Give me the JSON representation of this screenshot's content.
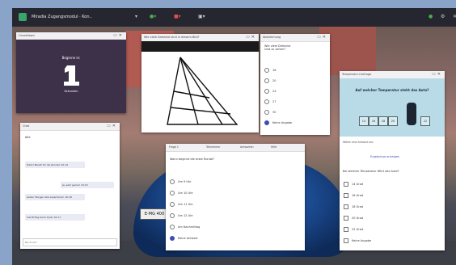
{
  "app": {
    "title": "Miradia Zugangsmodul · Kon..",
    "caret": "▾"
  },
  "countdown": {
    "title": "Countdown",
    "label_top": "Beginne in:",
    "label_bottom": "Sekunden"
  },
  "image_window": {
    "title": "Wie viele Dreiecke sind in diesem Bild?"
  },
  "poll": {
    "title": "Abstimmung",
    "question": "Wie viele Dreiecke sind zu sehen?",
    "options": [
      "16",
      "20",
      "24",
      "27",
      "30",
      "Keine Angabe"
    ],
    "selected": 5
  },
  "chat": {
    "title": "Chat",
    "header": "Alle",
    "messages": [
      {
        "text": "Hallo! Bereit für die Runde?",
        "time": "10:14"
      },
      {
        "text": "Ja, sehr gerne!",
        "time": "10:15"
      },
      {
        "text": "Guten Morgen alle zusammen!",
        "time": "10:16"
      },
      {
        "text": "Viel Erfolg beim Quiz!",
        "time": "10:17"
      }
    ],
    "input_placeholder": "Nachricht"
  },
  "bottom_window": {
    "tabs": [
      "Frage 1",
      "Teilnehmer",
      "Antworten",
      "Hilfe"
    ],
    "question": "Wann beginnt die erste Runde?",
    "options": [
      "Um 9 Uhr",
      "Um 10 Uhr",
      "Um 11 Uhr",
      "Um 12 Uhr",
      "Am Nachmittag",
      "Keine Antwort"
    ],
    "selected": 5
  },
  "temp_panel": {
    "title": "Temperatur-Umfrage",
    "banner_question": "Auf welcher Temperatur steht das Auto?",
    "cells": [
      "14",
      "16",
      "18",
      "20",
      "22"
    ],
    "subheader": "Wähle eine Antwort aus",
    "link": "Ergebnisse anzeigen",
    "question": "Bei welcher Temperatur fährt das Auto?",
    "options": [
      "14 Grad",
      "16 Grad",
      "18 Grad",
      "20 Grad",
      "22 Grad",
      "Keine Angabe"
    ]
  },
  "car": {
    "plate": "E-MG 400"
  }
}
